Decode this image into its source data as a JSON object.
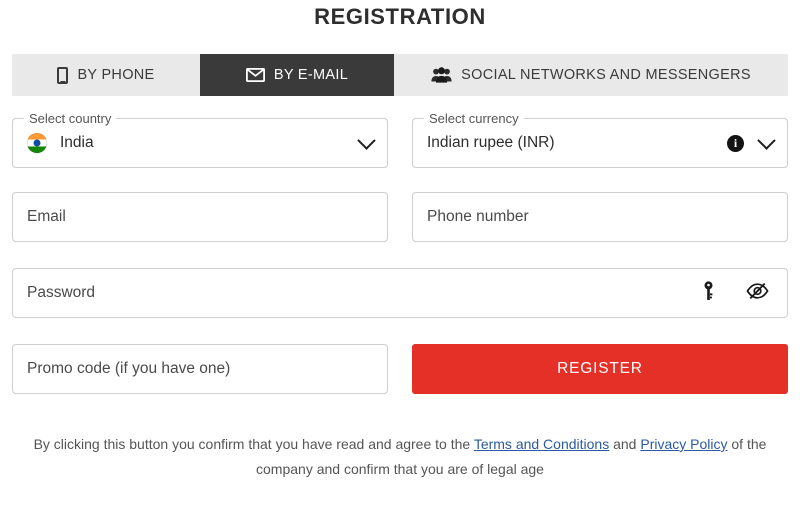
{
  "title": "REGISTRATION",
  "tabs": [
    {
      "label": "BY PHONE",
      "icon": "phone-icon",
      "active": false
    },
    {
      "label": "BY E-MAIL",
      "icon": "envelope-icon",
      "active": true
    },
    {
      "label": "SOCIAL NETWORKS AND MESSENGERS",
      "icon": "people-group-icon",
      "active": false
    }
  ],
  "country": {
    "label": "Select country",
    "value": "India",
    "flag": "india-flag-icon",
    "chevron": "chevron-down-icon"
  },
  "currency": {
    "label": "Select currency",
    "value": "Indian rupee (INR)",
    "info_icon": "info-icon",
    "info_glyph": "i",
    "chevron": "chevron-down-icon"
  },
  "fields": {
    "email_placeholder": "Email",
    "phone_placeholder": "Phone number",
    "password_placeholder": "Password",
    "promo_placeholder": "Promo code (if you have one)"
  },
  "password_icons": {
    "generate": "key-icon",
    "visibility": "eye-slash-icon"
  },
  "register_button": {
    "label": "REGISTER",
    "color": "#e53027"
  },
  "footer": {
    "text_before": "By clicking this button you confirm that you have read and agree to the",
    "link_terms": "Terms and Conditions",
    "text_middle": "and",
    "link_privacy": "Privacy Policy",
    "text_after": "of the company and confirm that you are of legal age",
    "link_color": "#2c5aa0"
  }
}
